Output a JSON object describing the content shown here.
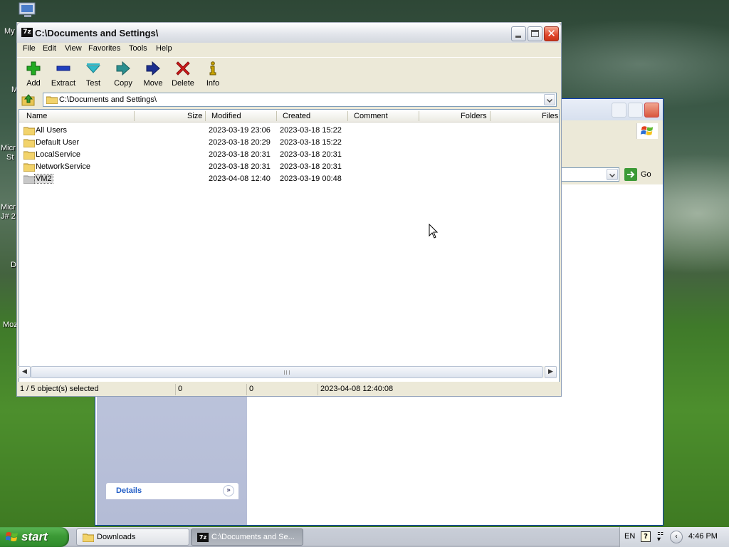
{
  "desktop": {
    "icon_labels": [
      "My",
      "Micr",
      "St",
      "Micr",
      "J# 2",
      "D",
      "Moz"
    ]
  },
  "background_window": {
    "address_go_label": "Go",
    "details_title": "Details"
  },
  "window": {
    "title": "C:\\Documents and Settings\\",
    "title_icon_text": "7z",
    "menu": [
      "File",
      "Edit",
      "View",
      "Favorites",
      "Tools",
      "Help"
    ],
    "toolbar": [
      {
        "label": "Add",
        "icon": "add-plus-icon",
        "color": "#22aa22"
      },
      {
        "label": "Extract",
        "icon": "extract-minus-icon",
        "color": "#1f3fbf"
      },
      {
        "label": "Test",
        "icon": "test-check-icon",
        "color": "#2fb9c9"
      },
      {
        "label": "Copy",
        "icon": "copy-arrow-icon",
        "color": "#2b8f8f"
      },
      {
        "label": "Move",
        "icon": "move-arrow-icon",
        "color": "#1c2f8f"
      },
      {
        "label": "Delete",
        "icon": "delete-x-icon",
        "color": "#d11b1b"
      },
      {
        "label": "Info",
        "icon": "info-icon",
        "color": "#c9a300"
      }
    ],
    "address": "C:\\Documents and Settings\\",
    "columns": [
      "Name",
      "Size",
      "Modified",
      "Created",
      "Comment",
      "Folders",
      "Files"
    ],
    "rows": [
      {
        "name": "All Users",
        "modified": "2023-03-19 23:06",
        "created": "2023-03-18 15:22",
        "selected": false
      },
      {
        "name": "Default User",
        "modified": "2023-03-18 20:29",
        "created": "2023-03-18 15:22",
        "selected": false
      },
      {
        "name": "LocalService",
        "modified": "2023-03-18 20:31",
        "created": "2023-03-18 20:31",
        "selected": false
      },
      {
        "name": "NetworkService",
        "modified": "2023-03-18 20:31",
        "created": "2023-03-18 20:31",
        "selected": false
      },
      {
        "name": "VM2",
        "modified": "2023-04-08 12:40",
        "created": "2023-03-19 00:48",
        "selected": true
      }
    ],
    "status": {
      "selection": "1 / 5 object(s) selected",
      "size": "0",
      "packed": "0",
      "modified": "2023-04-08 12:40:08"
    }
  },
  "taskbar": {
    "start_label": "start",
    "tasks": [
      {
        "label": "Downloads",
        "active": false
      },
      {
        "label": "C:\\Documents and Se...",
        "active": true
      }
    ],
    "tray": {
      "language": "EN",
      "help_glyph": "?",
      "time": "4:46 PM"
    }
  }
}
